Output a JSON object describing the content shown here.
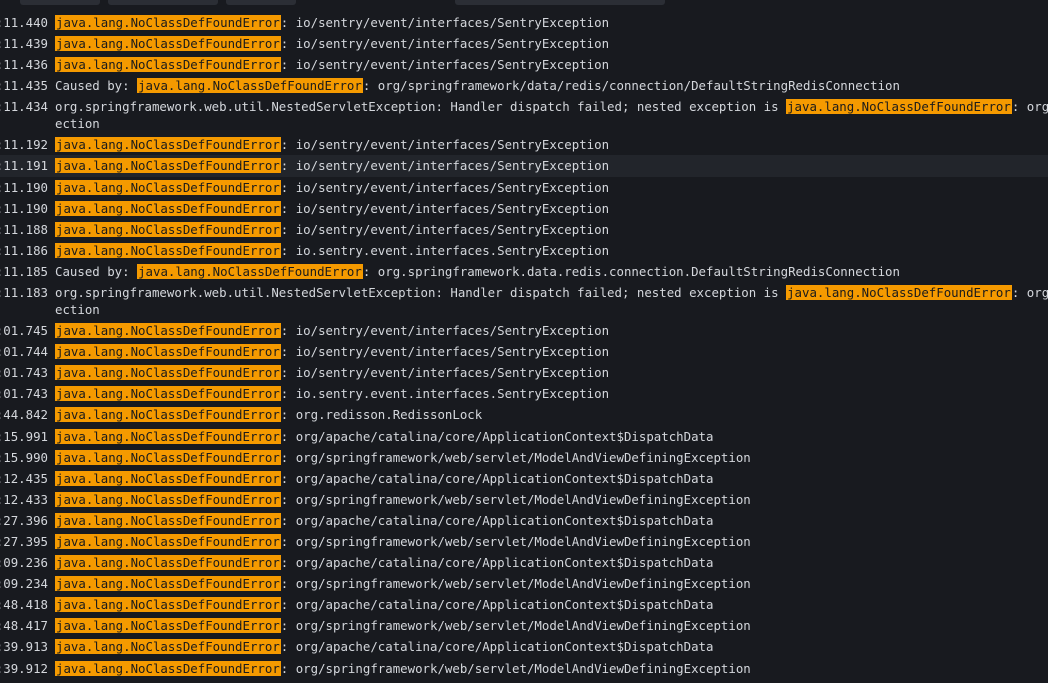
{
  "highlight_term": "java.lang.NoClassDefFoundError",
  "highlight_color": "#f59a00",
  "rows": [
    {
      "time": ":11.440",
      "pre": "",
      "hl": "java.lang.NoClassDefFoundError",
      "post": ": io/sentry/event/interfaces/SentryException"
    },
    {
      "time": ":11.439",
      "pre": "",
      "hl": "java.lang.NoClassDefFoundError",
      "post": ": io/sentry/event/interfaces/SentryException"
    },
    {
      "time": ":11.436",
      "pre": "",
      "hl": "java.lang.NoClassDefFoundError",
      "post": ": io/sentry/event/interfaces/SentryException"
    },
    {
      "time": ":11.435",
      "pre": "Caused by: ",
      "hl": "java.lang.NoClassDefFoundError",
      "post": ": org/springframework/data/redis/connection/DefaultStringRedisConnection"
    },
    {
      "time": ":11.434",
      "pre": "org.springframework.web.util.NestedServletException: Handler dispatch failed; nested exception is ",
      "hl": "java.lang.NoClassDefFoundError",
      "post": ": org/s",
      "cont": "ection"
    },
    {
      "time": ":11.192",
      "pre": "",
      "hl": "java.lang.NoClassDefFoundError",
      "post": ": io/sentry/event/interfaces/SentryException"
    },
    {
      "time": ":11.191",
      "pre": "",
      "hl": "java.lang.NoClassDefFoundError",
      "post": ": io/sentry/event/interfaces/SentryException"
    },
    {
      "time": ":11.190",
      "pre": "",
      "hl": "java.lang.NoClassDefFoundError",
      "post": ": io/sentry/event/interfaces/SentryException"
    },
    {
      "time": ":11.190",
      "pre": "",
      "hl": "java.lang.NoClassDefFoundError",
      "post": ": io/sentry/event/interfaces/SentryException"
    },
    {
      "time": ":11.188",
      "pre": "",
      "hl": "java.lang.NoClassDefFoundError",
      "post": ": io/sentry/event/interfaces/SentryException"
    },
    {
      "time": ":11.186",
      "pre": "",
      "hl": "java.lang.NoClassDefFoundError",
      "post": ": io.sentry.event.interfaces.SentryException"
    },
    {
      "time": ":11.185",
      "pre": "Caused by: ",
      "hl": "java.lang.NoClassDefFoundError",
      "post": ": org.springframework.data.redis.connection.DefaultStringRedisConnection"
    },
    {
      "time": ":11.183",
      "pre": "org.springframework.web.util.NestedServletException: Handler dispatch failed; nested exception is ",
      "hl": "java.lang.NoClassDefFoundError",
      "post": ": org.s",
      "cont": "ection"
    },
    {
      "time": ":01.745",
      "pre": "",
      "hl": "java.lang.NoClassDefFoundError",
      "post": ": io/sentry/event/interfaces/SentryException"
    },
    {
      "time": ":01.744",
      "pre": "",
      "hl": "java.lang.NoClassDefFoundError",
      "post": ": io/sentry/event/interfaces/SentryException"
    },
    {
      "time": ":01.743",
      "pre": "",
      "hl": "java.lang.NoClassDefFoundError",
      "post": ": io/sentry/event/interfaces/SentryException"
    },
    {
      "time": ":01.743",
      "pre": "",
      "hl": "java.lang.NoClassDefFoundError",
      "post": ": io.sentry.event.interfaces.SentryException"
    },
    {
      "time": ":44.842",
      "pre": "",
      "hl": "java.lang.NoClassDefFoundError",
      "post": ": org.redisson.RedissonLock"
    },
    {
      "time": ":15.991",
      "pre": "",
      "hl": "java.lang.NoClassDefFoundError",
      "post": ": org/apache/catalina/core/ApplicationContext$DispatchData"
    },
    {
      "time": ":15.990",
      "pre": "",
      "hl": "java.lang.NoClassDefFoundError",
      "post": ": org/springframework/web/servlet/ModelAndViewDefiningException"
    },
    {
      "time": ":12.435",
      "pre": "",
      "hl": "java.lang.NoClassDefFoundError",
      "post": ": org/apache/catalina/core/ApplicationContext$DispatchData"
    },
    {
      "time": ":12.433",
      "pre": "",
      "hl": "java.lang.NoClassDefFoundError",
      "post": ": org/springframework/web/servlet/ModelAndViewDefiningException"
    },
    {
      "time": ":27.396",
      "pre": "",
      "hl": "java.lang.NoClassDefFoundError",
      "post": ": org/apache/catalina/core/ApplicationContext$DispatchData"
    },
    {
      "time": ":27.395",
      "pre": "",
      "hl": "java.lang.NoClassDefFoundError",
      "post": ": org/springframework/web/servlet/ModelAndViewDefiningException"
    },
    {
      "time": ":09.236",
      "pre": "",
      "hl": "java.lang.NoClassDefFoundError",
      "post": ": org/apache/catalina/core/ApplicationContext$DispatchData"
    },
    {
      "time": ":09.234",
      "pre": "",
      "hl": "java.lang.NoClassDefFoundError",
      "post": ": org/springframework/web/servlet/ModelAndViewDefiningException"
    },
    {
      "time": ":48.418",
      "pre": "",
      "hl": "java.lang.NoClassDefFoundError",
      "post": ": org/apache/catalina/core/ApplicationContext$DispatchData"
    },
    {
      "time": ":48.417",
      "pre": "",
      "hl": "java.lang.NoClassDefFoundError",
      "post": ": org/springframework/web/servlet/ModelAndViewDefiningException"
    },
    {
      "time": ":39.913",
      "pre": "",
      "hl": "java.lang.NoClassDefFoundError",
      "post": ": org/apache/catalina/core/ApplicationContext$DispatchData"
    },
    {
      "time": ":39.912",
      "pre": "",
      "hl": "java.lang.NoClassDefFoundError",
      "post": ": org/springframework/web/servlet/ModelAndViewDefiningException"
    }
  ]
}
